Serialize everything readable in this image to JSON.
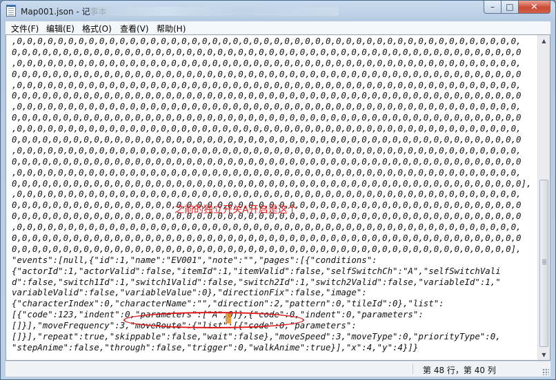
{
  "window": {
    "title": "Map001.json - 记事本",
    "controls": {
      "minimize": "–",
      "maximize": "□",
      "close": "✕"
    }
  },
  "menu": {
    "items": [
      {
        "label": "文件(F)"
      },
      {
        "label": "编辑(E)"
      },
      {
        "label": "格式(O)"
      },
      {
        "label": "查看(V)"
      },
      {
        "label": "帮助(H)"
      }
    ]
  },
  "editor": {
    "lines": [
      ",0,0,0,0,0,0,0,0,0,0,0,0,0,0,0,0,0,0,0,0,0,0,0,0,0,0,0,0,0,0,0,0,0,0,0,0,0,0,0,0,0,0,0,0,0,0,0,0,0,",
      "0,0,0,0,0,0,0,0,0,0,0,0,0,0,0,0,0,0,0,0,0,0,0,0,0,0,0,0,0,0,0,0,0,0,0,0,0,0,0,0,0,0,0,0,0,0,0,0,0,0",
      ",0,0,0,0,0,0,0,0,0,0,0,0,0,0,0,0,0,0,0,0,0,0,0,0,0,0,0,0,0,0,0,0,0,0,0,0,0,0,0,0,0,0,0,0,0,0,0,0,0,",
      "0,0,0,0,0,0,0,0,0,0,0,0,0,0,0,0,0,0,0,0,0,0,0,0,0,0,0,0,0,0,0,0,0,0,0,0,0,0,0,0,0,0,0,0,0,0,0,0,0,0",
      ",0,0,0,0,0,0,0,0,0,0,0,0,0,0,0,0,0,0,0,0,0,0,0,0,0,0,0,0,0,0,0,0,0,0,0,0,0,0,0,0,0,0,0,0,0,0,0,0,0,",
      "0,0,0,0,0,0,0,0,0,0,0,0,0,0,0,0,0,0,0,0,0,0,0,0,0,0,0,0,0,0,0,0,0,0,0,0,0,0,0,0,0,0,0,0,0,0,0,0,0,0",
      ",0,0,0,0,0,0,0,0,0,0,0,0,0,0,0,0,0,0,0,0,0,0,0,0,0,0,0,0,0,0,0,0,0,0,0,0,0,0,0,0,0,0,0,0,0,0,0,0,0,",
      "0,0,0,0,0,0,0,0,0,0,0,0,0,0,0,0,0,0,0,0,0,0,0,0,0,0,0,0,0,0,0,0,0,0,0,0,0,0,0,0,0,0,0,0,0,0,0,0,0,0",
      ",0,0,0,0,0,0,0,0,0,0,0,0,0,0,0,0,0,0,0,0,0,0,0,0,0,0,0,0,0,0,0,0,0,0,0,0,0,0,0,0,0,0,0,0,0,0,0,0,0,",
      "0,0,0,0,0,0,0,0,0,0,0,0,0,0,0,0,0,0,0,0,0,0,0,0,0,0,0,0,0,0,0,0,0,0,0,0,0,0,0,0,0,0,0,0,0,0,0,0,0,0",
      ",0,0,0,0,0,0,0,0,0,0,0,0,0,0,0,0,0,0,0,0,0,0,0,0,0,0,0,0,0,0,0,0,0,0,0,0,0,0,0,0,0,0,0,0,0,0,0,0,0,",
      "0,0,0,0,0,0,0,0,0,0,0,0,0,0,0,0,0,0,0,0,0,0,0,0,0,0,0,0,0,0,0,0,0,0,0,0,0,0,0,0,0,0,0,0,0,0,0,0,0,0",
      ",0,0,0,0,0,0,0,0,0,0,0,0,0,0,0,0,0,0,0,0,0,0,0,0,0,0,0,0,0,0,0,0,0,0,0,0,0,0,0,0,0,0,0,0,0,0,0,0,0,",
      "0,0,0,0,0,0,0,0,0,0,0,0,0,0,0,0,0,0,0,0,0,0,0,0,0,0,0,0,0,0,0,0,0,0,0,0,0,0,0,0,0,0,0,0,0,0,0,0,0,0],",
      ",0,0,0,0,0,0,0,0,0,0,0,0,0,0,0,0,0,0,0,0,0,0,0,0,0,0,0,0,0,0,0,0,0,0,0,0,0,0,0,0,0,0,0,0,0,0,0,0,0,",
      "0,0,0,0,0,0,0,0,0,0,0,0,0,0,0,0,0,0,0,0,0,0,0,0,0,0,0,0,0,0,0,0,0,0,0,0,0,0,0,0,0,0,0,0,0,0,0,0,0,0",
      "0,0,0,0,0,0,0,0,0,0,0,0,0,0,0,0,0,0,0,0,0,0,0,0,0,0,0,0,0,0,0,0,0,0,0,0,0,0,0,0,0,0,0,0,0,0,0,0,0,0",
      ",0,0,0,0,0,0,0,0,0,0,0,0,0,0,0,0,0,0,0,0,0,0,0,0,0,0,0,0,0,0,0,0,0,0,0,0,0,0,0,0,0,0,0,0,0,0,0,0,0,",
      "0,0,0,0,0,0,0,0,0,0,0,0,0,0,0,0,0,0,0,0,0,0,0,0,0,0,0,0,0,0,0,0,0,0,0,0,0,0,0,0,0,0,0,0,0,0,0,0,0,0",
      "0,0,0,0,0,0,0,0,0,0,0,0,0,0,0,0,0,0,0,0,0,0,0,0,0,0,0,0,0,0,0,0,0,0,0,0,0,0,0,0,0,0,0,0,0,0,0,0,0],",
      "\"events\":[null,{\"id\":1,\"name\":\"EV001\",\"note\":\"\",\"pages\":[{\"conditions\":",
      "{\"actorId\":1,\"actorValid\":false,\"itemId\":1,\"itemValid\":false,\"selfSwitchCh\":\"A\",\"selfSwitchVali",
      "d\":false,\"switch1Id\":1,\"switch1Valid\":false,\"switch2Id\":1,\"switch2Valid\":false,\"variableId\":1,\"",
      "variableValid\":false,\"variableValue\":0},\"directionFix\":false,\"image\":",
      "{\"characterIndex\":0,\"characterName\":\"\",\"direction\":2,\"pattern\":0,\"tileId\":0},\"list\":",
      "[{\"code\":123,\"indent\":0,\"parameters\":[\"A\",0]},{\"code\":0,\"indent\":0,\"parameters\":",
      "[]}],\"moveFrequency\":3,\"moveRoute\":{\"list\":[{\"code\":0,\"parameters\":",
      "[]}],\"repeat\":true,\"skippable\":false,\"wait\":false},\"moveSpeed\":3,\"moveType\":0,\"priorityType\":0,",
      "\"stepAnime\":false,\"through\":false,\"trigger\":0,\"walkAnime\":true}],\"x\":4,\"y\":4}]}"
    ],
    "annotation": "之前的独立开关A开启是这个"
  },
  "status": {
    "position": "第 48 行，第 40 列"
  },
  "colors": {
    "annotation": "#e61c1c",
    "caret_highlight": "#e08a1a"
  }
}
